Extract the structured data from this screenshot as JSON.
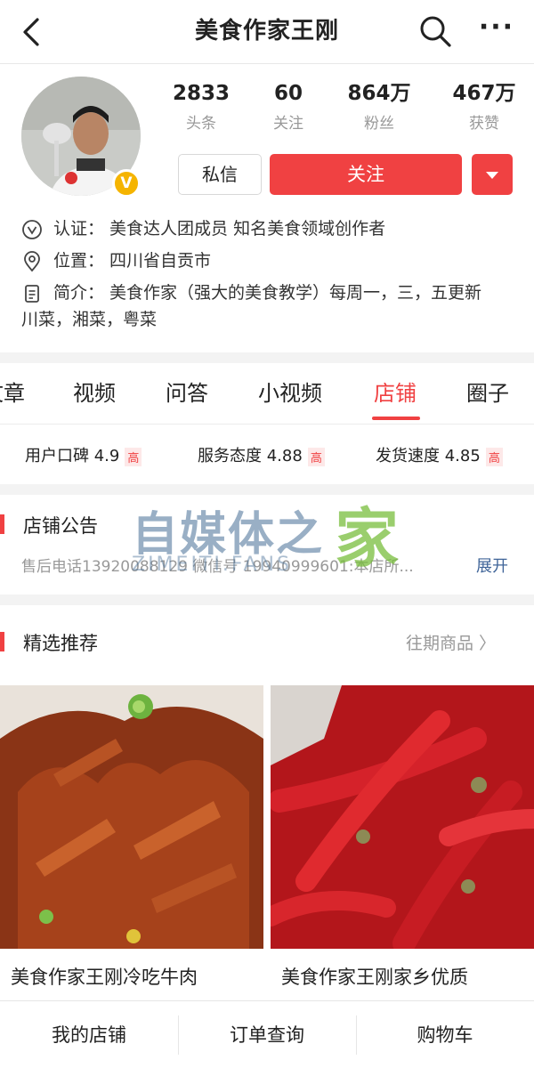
{
  "header": {
    "title": "美食作家王刚",
    "more_label": "···"
  },
  "profile": {
    "badge_label": "V",
    "stats": [
      {
        "value": "2833",
        "label": "头条"
      },
      {
        "value": "60",
        "label": "关注"
      },
      {
        "value": "864万",
        "label": "粉丝"
      },
      {
        "value": "467万",
        "label": "获赞"
      }
    ],
    "message_label": "私信",
    "follow_label": "关注",
    "certification": "认证：  美食达人团成员 知名美食领域创作者",
    "location": "位置：  四川省自贡市",
    "intro": "简介：  美食作家（强大的美食教学）每周一，三，五更新川菜，湘菜，粤菜"
  },
  "tabs": [
    {
      "label": "文章"
    },
    {
      "label": "视频"
    },
    {
      "label": "问答"
    },
    {
      "label": "小视频"
    },
    {
      "label": "店铺"
    },
    {
      "label": "圈子"
    }
  ],
  "ratings": [
    {
      "label": "用户口碑 4.9",
      "badge": "高"
    },
    {
      "label": "服务态度 4.88",
      "badge": "高"
    },
    {
      "label": "发货速度 4.85",
      "badge": "高"
    }
  ],
  "notice": {
    "title": "店铺公告",
    "text": "售后电话13920088129 微信号 19940999601:本店所...",
    "expand_label": "展开"
  },
  "watermark": {
    "main": "自媒体之",
    "home": "家",
    "sub": "ZIMEITI.FANS"
  },
  "featured": {
    "title": "精选推荐",
    "more_label": "往期商品 〉"
  },
  "products": [
    {
      "name": "美食作家王刚冷吃牛肉"
    },
    {
      "name": "美食作家王刚家乡优质"
    }
  ],
  "bottom_nav": [
    {
      "label": "我的店铺"
    },
    {
      "label": "订单查询"
    },
    {
      "label": "购物车"
    }
  ],
  "colors": {
    "accent": "#f04142",
    "link": "#406599",
    "muted": "#999999"
  }
}
